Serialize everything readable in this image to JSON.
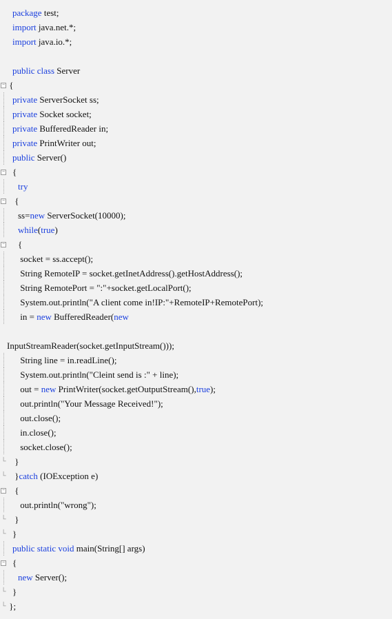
{
  "code": {
    "lines": [
      {
        "indent": 1,
        "gutter": "",
        "tokens": [
          [
            "kw",
            "package"
          ],
          [
            "txt",
            " test;"
          ]
        ]
      },
      {
        "indent": 1,
        "gutter": "",
        "tokens": [
          [
            "kw",
            "import"
          ],
          [
            "txt",
            " java.net.*;"
          ]
        ]
      },
      {
        "indent": 1,
        "gutter": "",
        "tokens": [
          [
            "kw",
            "import"
          ],
          [
            "txt",
            " java.io.*;"
          ]
        ]
      },
      {
        "indent": 0,
        "gutter": "",
        "tokens": [
          [
            "txt",
            " "
          ]
        ]
      },
      {
        "indent": 1,
        "gutter": "",
        "tokens": [
          [
            "kw",
            "public class"
          ],
          [
            "txt",
            " Server"
          ]
        ]
      },
      {
        "indent": 0,
        "gutter": "fold",
        "tokens": [
          [
            "txt",
            " {"
          ]
        ]
      },
      {
        "indent": 1,
        "gutter": "guide",
        "tokens": [
          [
            "kw",
            "private"
          ],
          [
            "txt",
            " ServerSocket ss;"
          ]
        ]
      },
      {
        "indent": 1,
        "gutter": "guide",
        "tokens": [
          [
            "kw",
            "private"
          ],
          [
            "txt",
            " Socket socket;"
          ]
        ]
      },
      {
        "indent": 1,
        "gutter": "guide",
        "tokens": [
          [
            "kw",
            "private"
          ],
          [
            "txt",
            " BufferedReader in;"
          ]
        ]
      },
      {
        "indent": 1,
        "gutter": "guide",
        "tokens": [
          [
            "kw",
            "private"
          ],
          [
            "txt",
            " PrintWriter out;"
          ]
        ]
      },
      {
        "indent": 1,
        "gutter": "guide",
        "tokens": [
          [
            "kw",
            "public"
          ],
          [
            "txt",
            " Server()"
          ]
        ]
      },
      {
        "indent": 1,
        "gutter": "fold",
        "tokens": [
          [
            "txt",
            "{"
          ]
        ]
      },
      {
        "indent": 2,
        "gutter": "guide",
        "tokens": [
          [
            "kw",
            "try"
          ]
        ]
      },
      {
        "indent": 1,
        "gutter": "fold",
        "tokens": [
          [
            "txt",
            " {"
          ]
        ]
      },
      {
        "indent": 2,
        "gutter": "guide",
        "tokens": [
          [
            "txt",
            "ss="
          ],
          [
            "kw",
            "new"
          ],
          [
            "txt",
            " ServerSocket(10000);"
          ]
        ]
      },
      {
        "indent": 2,
        "gutter": "guide",
        "tokens": [
          [
            "kw",
            "while"
          ],
          [
            "txt",
            "("
          ],
          [
            "kw",
            "true"
          ],
          [
            "txt",
            ")"
          ]
        ]
      },
      {
        "indent": 2,
        "gutter": "fold",
        "tokens": [
          [
            "txt",
            "{"
          ]
        ]
      },
      {
        "indent": 2,
        "gutter": "guide",
        "tokens": [
          [
            "txt",
            " socket = ss.accept();"
          ]
        ]
      },
      {
        "indent": 2,
        "gutter": "guide",
        "tokens": [
          [
            "txt",
            " String RemoteIP = socket.getInetAddress().getHostAddress();"
          ]
        ]
      },
      {
        "indent": 2,
        "gutter": "guide",
        "tokens": [
          [
            "txt",
            " String RemotePort = \":\"+socket.getLocalPort();"
          ]
        ]
      },
      {
        "indent": 2,
        "gutter": "guide",
        "tokens": [
          [
            "txt",
            " System.out.println(\"A client come in!IP:\"+RemoteIP+RemotePort);"
          ]
        ]
      },
      {
        "indent": 2,
        "gutter": "guide",
        "tokens": [
          [
            "txt",
            " in = "
          ],
          [
            "kw",
            "new"
          ],
          [
            "txt",
            " BufferedReader("
          ],
          [
            "kw",
            "new"
          ]
        ]
      },
      {
        "indent": 0,
        "gutter": "",
        "tokens": [
          [
            "txt",
            " "
          ]
        ]
      },
      {
        "indent": 0,
        "gutter": "",
        "tokens": [
          [
            "txt",
            "InputStreamReader(socket.getInputStream()));"
          ]
        ]
      },
      {
        "indent": 2,
        "gutter": "guide",
        "tokens": [
          [
            "txt",
            " String line = in.readLine();"
          ]
        ]
      },
      {
        "indent": 2,
        "gutter": "guide",
        "tokens": [
          [
            "txt",
            " System.out.println(\"Cleint send is :\" + line);"
          ]
        ]
      },
      {
        "indent": 2,
        "gutter": "guide",
        "tokens": [
          [
            "txt",
            " out = "
          ],
          [
            "kw",
            "new"
          ],
          [
            "txt",
            " PrintWriter(socket.getOutputStream(),"
          ],
          [
            "kw",
            "true"
          ],
          [
            "txt",
            ");"
          ]
        ]
      },
      {
        "indent": 2,
        "gutter": "guide",
        "tokens": [
          [
            "txt",
            " out.println(\"Your Message Received!\");"
          ]
        ]
      },
      {
        "indent": 2,
        "gutter": "guide",
        "tokens": [
          [
            "txt",
            " out.close();"
          ]
        ]
      },
      {
        "indent": 2,
        "gutter": "guide",
        "tokens": [
          [
            "txt",
            " in.close();"
          ]
        ]
      },
      {
        "indent": 2,
        "gutter": "guide",
        "tokens": [
          [
            "txt",
            " socket.close();"
          ]
        ]
      },
      {
        "indent": 1,
        "gutter": "corner",
        "tokens": [
          [
            "txt",
            " }"
          ]
        ]
      },
      {
        "indent": 1,
        "gutter": "corner",
        "tokens": [
          [
            "txt",
            " }"
          ],
          [
            "kw",
            "catch"
          ],
          [
            "txt",
            " (IOException e)"
          ]
        ]
      },
      {
        "indent": 1,
        "gutter": "fold",
        "tokens": [
          [
            "txt",
            " {"
          ]
        ]
      },
      {
        "indent": 2,
        "gutter": "guide",
        "tokens": [
          [
            "txt",
            " out.println(\"wrong\");"
          ]
        ]
      },
      {
        "indent": 1,
        "gutter": "corner",
        "tokens": [
          [
            "txt",
            " }"
          ]
        ]
      },
      {
        "indent": 1,
        "gutter": "corner",
        "tokens": [
          [
            "txt",
            "}"
          ]
        ]
      },
      {
        "indent": 1,
        "gutter": "guide",
        "tokens": [
          [
            "kw",
            "public static void"
          ],
          [
            "txt",
            " main(String[] args)"
          ]
        ]
      },
      {
        "indent": 1,
        "gutter": "fold",
        "tokens": [
          [
            "txt",
            "{"
          ]
        ]
      },
      {
        "indent": 2,
        "gutter": "guide",
        "tokens": [
          [
            "kw",
            "new"
          ],
          [
            "txt",
            " Server();"
          ]
        ]
      },
      {
        "indent": 1,
        "gutter": "corner",
        "tokens": [
          [
            "txt",
            "}"
          ]
        ]
      },
      {
        "indent": 0,
        "gutter": "corner",
        "tokens": [
          [
            "txt",
            " };"
          ]
        ]
      }
    ]
  }
}
